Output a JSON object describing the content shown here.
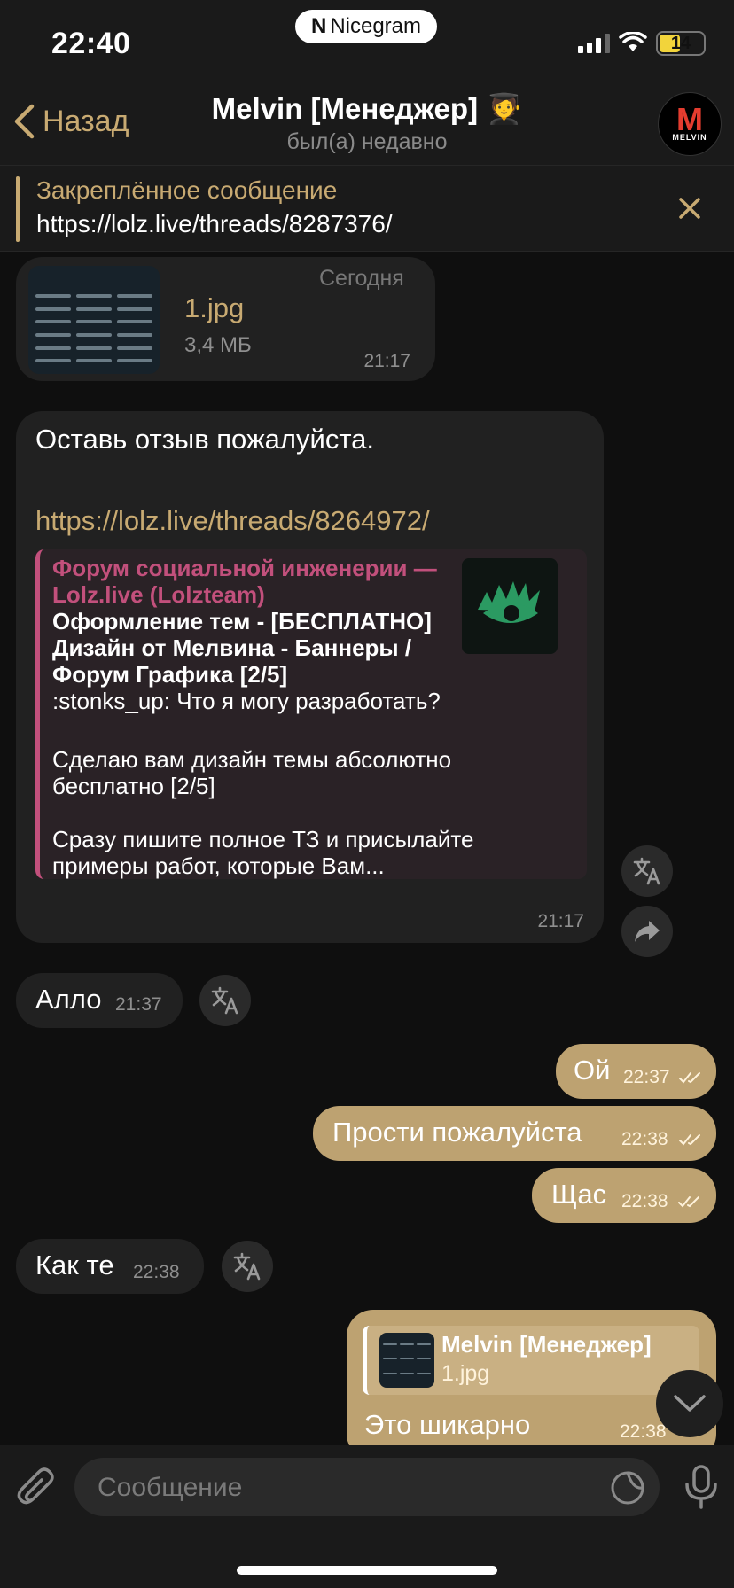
{
  "status_bar": {
    "time": "22:40",
    "app_name": "Nicegram",
    "battery": "14"
  },
  "header": {
    "back_label": "Назад",
    "title": "Melvin [Менеджер] 🧑‍🎓",
    "subtitle": "был(а) недавно",
    "avatar_letter": "M",
    "avatar_text": "MELVIN"
  },
  "pinned": {
    "title": "Закреплённое сообщение",
    "text": "https://lolz.live/threads/8287376/"
  },
  "messages": {
    "file": {
      "date_badge": "Сегодня",
      "name": "1.jpg",
      "size": "3,4 МБ",
      "time": "21:17"
    },
    "review": {
      "text": "Оставь отзыв пожалуйста.",
      "link": "https://lolz.live/threads/8264972/",
      "preview_site": "Форум социальной инженерии — Lolz.live (Lolzteam)",
      "preview_title": "Оформление тем - [БЕСПЛАТНО] Дизайн от Мелвина - Баннеры / Форум Графика [2/5]",
      "preview_line1": ":stonks_up: Что я могу разработать?",
      "preview_line2": "Сделаю вам дизайн темы абсолютно бесплатно [2/5]",
      "preview_line3": "Сразу пишите полное ТЗ и присылайте примеры работ, которые Вам...",
      "time": "21:17"
    },
    "allo": {
      "text": "Алло",
      "time": "21:37"
    },
    "oy": {
      "text": "Ой",
      "time": "22:37"
    },
    "sorry": {
      "text": "Прости пожалуйста",
      "time": "22:38"
    },
    "now": {
      "text": "Щас",
      "time": "22:38"
    },
    "kak": {
      "text": "Как те",
      "time": "22:38"
    },
    "reply": {
      "author": "Melvin [Менеджер]",
      "file": "1.jpg",
      "text": "Это шикарно",
      "time": "22:38"
    }
  },
  "composer": {
    "placeholder": "Сообщение"
  },
  "colors": {
    "accent": "#c8aa72",
    "outgoing": "#bda271",
    "incoming": "#212121",
    "link_preview_bar": "#c2507c"
  }
}
